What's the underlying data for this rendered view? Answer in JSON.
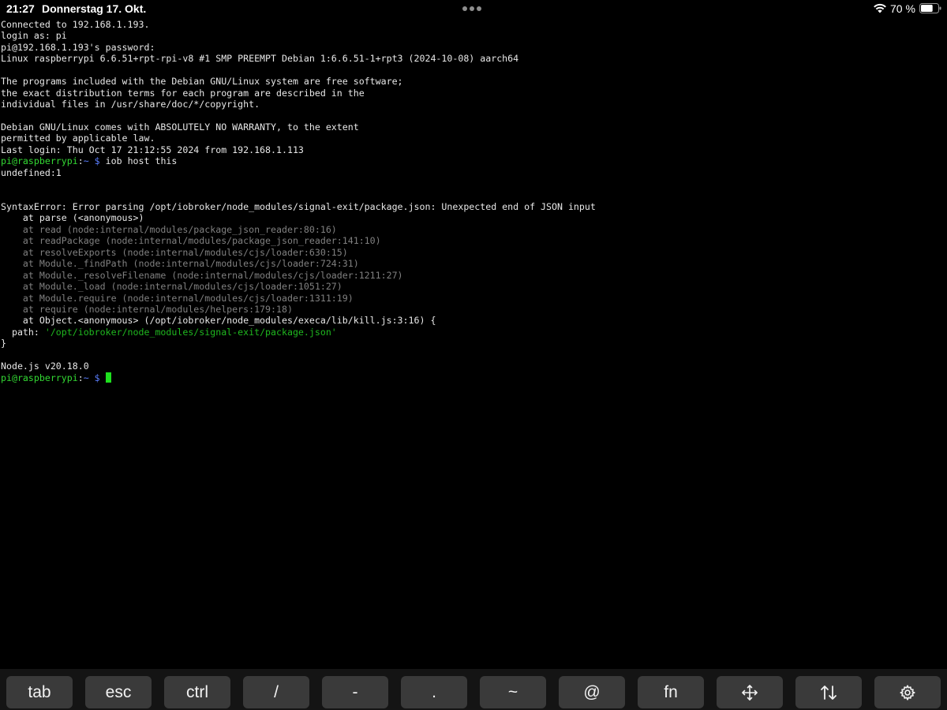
{
  "statusbar": {
    "time": "21:27",
    "date": "Donnerstag 17. Okt.",
    "battery_percent": "70 %",
    "battery_level": 0.7
  },
  "terminal": {
    "lines": [
      {
        "segments": [
          {
            "text": "Connected to 192.168.1.193.",
            "style": "normal"
          }
        ]
      },
      {
        "segments": [
          {
            "text": "login as: pi",
            "style": "normal"
          }
        ]
      },
      {
        "segments": [
          {
            "text": "pi@192.168.1.193's password:",
            "style": "normal"
          }
        ]
      },
      {
        "segments": [
          {
            "text": "Linux raspberrypi 6.6.51+rpt-rpi-v8 #1 SMP PREEMPT Debian 1:6.6.51-1+rpt3 (2024-10-08) aarch64",
            "style": "normal"
          }
        ]
      },
      {
        "segments": []
      },
      {
        "segments": [
          {
            "text": "The programs included with the Debian GNU/Linux system are free software;",
            "style": "normal"
          }
        ]
      },
      {
        "segments": [
          {
            "text": "the exact distribution terms for each program are described in the",
            "style": "normal"
          }
        ]
      },
      {
        "segments": [
          {
            "text": "individual files in /usr/share/doc/*/copyright.",
            "style": "normal"
          }
        ]
      },
      {
        "segments": []
      },
      {
        "segments": [
          {
            "text": "Debian GNU/Linux comes with ABSOLUTELY NO WARRANTY, to the extent",
            "style": "normal"
          }
        ]
      },
      {
        "segments": [
          {
            "text": "permitted by applicable law.",
            "style": "normal"
          }
        ]
      },
      {
        "segments": [
          {
            "text": "Last login: Thu Oct 17 21:12:55 2024 from 192.168.1.113",
            "style": "normal"
          }
        ]
      },
      {
        "segments": [
          {
            "text": "pi@raspberrypi",
            "style": "green"
          },
          {
            "text": ":",
            "style": "normal"
          },
          {
            "text": "~ $",
            "style": "blue"
          },
          {
            "text": " iob host this",
            "style": "normal"
          }
        ]
      },
      {
        "segments": [
          {
            "text": "undefined:1",
            "style": "normal"
          }
        ]
      },
      {
        "segments": []
      },
      {
        "segments": []
      },
      {
        "segments": [
          {
            "text": "SyntaxError: Error parsing /opt/iobroker/node_modules/signal-exit/package.json: Unexpected end of JSON input",
            "style": "normal"
          }
        ]
      },
      {
        "segments": [
          {
            "text": "    at parse (<anonymous>)",
            "style": "normal"
          }
        ]
      },
      {
        "segments": [
          {
            "text": "    at read (node:internal/modules/package_json_reader:80:16)",
            "style": "dim"
          }
        ]
      },
      {
        "segments": [
          {
            "text": "    at readPackage (node:internal/modules/package_json_reader:141:10)",
            "style": "dim"
          }
        ]
      },
      {
        "segments": [
          {
            "text": "    at resolveExports (node:internal/modules/cjs/loader:630:15)",
            "style": "dim"
          }
        ]
      },
      {
        "segments": [
          {
            "text": "    at Module._findPath (node:internal/modules/cjs/loader:724:31)",
            "style": "dim"
          }
        ]
      },
      {
        "segments": [
          {
            "text": "    at Module._resolveFilename (node:internal/modules/cjs/loader:1211:27)",
            "style": "dim"
          }
        ]
      },
      {
        "segments": [
          {
            "text": "    at Module._load (node:internal/modules/cjs/loader:1051:27)",
            "style": "dim"
          }
        ]
      },
      {
        "segments": [
          {
            "text": "    at Module.require (node:internal/modules/cjs/loader:1311:19)",
            "style": "dim"
          }
        ]
      },
      {
        "segments": [
          {
            "text": "    at require (node:internal/modules/helpers:179:18)",
            "style": "dim"
          }
        ]
      },
      {
        "segments": [
          {
            "text": "    at Object.<anonymous> (/opt/iobroker/node_modules/execa/lib/kill.js:3:16) {",
            "style": "normal"
          }
        ]
      },
      {
        "segments": [
          {
            "text": "  path: ",
            "style": "normal"
          },
          {
            "text": "'/opt/iobroker/node_modules/signal-exit/package.json'",
            "style": "path"
          }
        ]
      },
      {
        "segments": [
          {
            "text": "}",
            "style": "normal"
          }
        ]
      },
      {
        "segments": []
      },
      {
        "segments": [
          {
            "text": "Node.js v20.18.0",
            "style": "normal"
          }
        ]
      },
      {
        "segments": [
          {
            "text": "pi@raspberrypi",
            "style": "green"
          },
          {
            "text": ":",
            "style": "normal"
          },
          {
            "text": "~ $",
            "style": "blue"
          },
          {
            "text": " ",
            "style": "normal"
          }
        ],
        "cursor": true
      }
    ]
  },
  "keybar": {
    "keys": [
      {
        "name": "tab-key",
        "label": "tab",
        "icon": null
      },
      {
        "name": "esc-key",
        "label": "esc",
        "icon": null
      },
      {
        "name": "ctrl-key",
        "label": "ctrl",
        "icon": null
      },
      {
        "name": "slash-key",
        "label": "/",
        "icon": null
      },
      {
        "name": "dash-key",
        "label": "-",
        "icon": null
      },
      {
        "name": "dot-key",
        "label": ".",
        "icon": null
      },
      {
        "name": "tilde-key",
        "label": "~",
        "icon": null
      },
      {
        "name": "at-key",
        "label": "@",
        "icon": null
      },
      {
        "name": "fn-key",
        "label": "fn",
        "icon": null
      },
      {
        "name": "move-key",
        "label": "",
        "icon": "move-arrows-icon"
      },
      {
        "name": "arrows-key",
        "label": "",
        "icon": "up-down-arrows-icon"
      },
      {
        "name": "settings-key",
        "label": "",
        "icon": "gear-icon"
      }
    ]
  }
}
